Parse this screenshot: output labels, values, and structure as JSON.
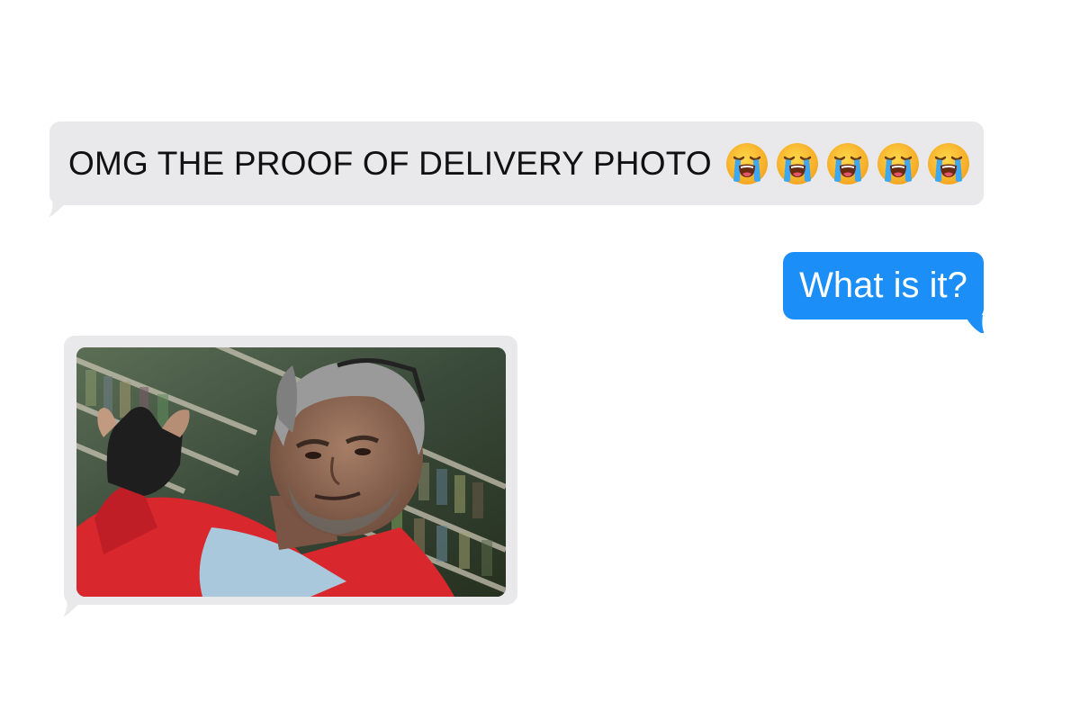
{
  "messages": [
    {
      "direction": "incoming",
      "type": "text",
      "text": "OMG THE PROOF OF DELIVERY PHOTO",
      "emoji": [
        "loudly-crying-face",
        "loudly-crying-face",
        "loudly-crying-face",
        "loudly-crying-face",
        "loudly-crying-face"
      ]
    },
    {
      "direction": "outgoing",
      "type": "text",
      "text": "What is it?"
    },
    {
      "direction": "incoming",
      "type": "image",
      "image_subject": "man-in-red-jacket-photo"
    }
  ],
  "colors": {
    "incoming_bubble": "#e9e9eb",
    "outgoing_bubble": "#1b8ef8",
    "incoming_text": "#111111",
    "outgoing_text": "#ffffff",
    "background": "#ffffff"
  }
}
